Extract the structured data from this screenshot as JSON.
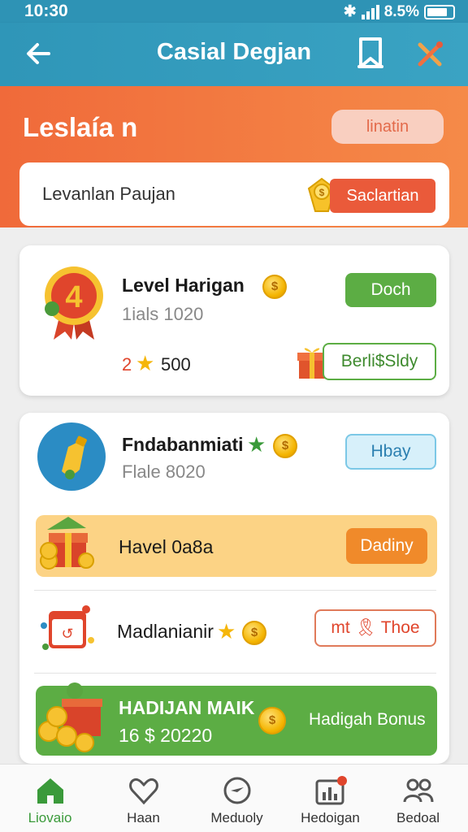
{
  "status": {
    "time": "10:30",
    "battery": "8.5%"
  },
  "appbar": {
    "title": "Casial Degjan"
  },
  "banner": {
    "title": "Leslaía n",
    "pill": "linatin"
  },
  "search": {
    "label": "Levanlan Paujan",
    "button": "Saclartian"
  },
  "card1": {
    "title": "Level Harigan",
    "subtitle": "1ials 1020",
    "stars_value": "500",
    "stars_prefix": "2",
    "badge_number": "4",
    "action": "Doch",
    "reward_button": "Berli$Sldy"
  },
  "card2": {
    "title": "Fndabanmiati",
    "subtitle": "Flale 8020",
    "action": "Hbay"
  },
  "promo": {
    "label": "Havel 0a8a",
    "button": "Dadiny"
  },
  "daily": {
    "label": "Madlanianir",
    "button": "mt 🎗 Thoe"
  },
  "bonus": {
    "title": "HADIJAN MAIK",
    "amount": "16 $ 20220",
    "label": "Hadigah Bonus"
  },
  "nav": [
    {
      "label": "Liovaio",
      "icon": "home-icon",
      "active": true
    },
    {
      "label": "Haan",
      "icon": "heart-icon",
      "active": false
    },
    {
      "label": "Meduoly",
      "icon": "compass-icon",
      "active": false
    },
    {
      "label": "Hedoigan",
      "icon": "stats-icon",
      "active": false
    },
    {
      "label": "Bedoal",
      "icon": "people-icon",
      "active": false
    }
  ],
  "colors": {
    "appbar": "#2f96b8",
    "orange": "#f06a3a",
    "green": "#5cad44",
    "promo_bg": "#fcd385",
    "accent_orange": "#f08a2a"
  }
}
